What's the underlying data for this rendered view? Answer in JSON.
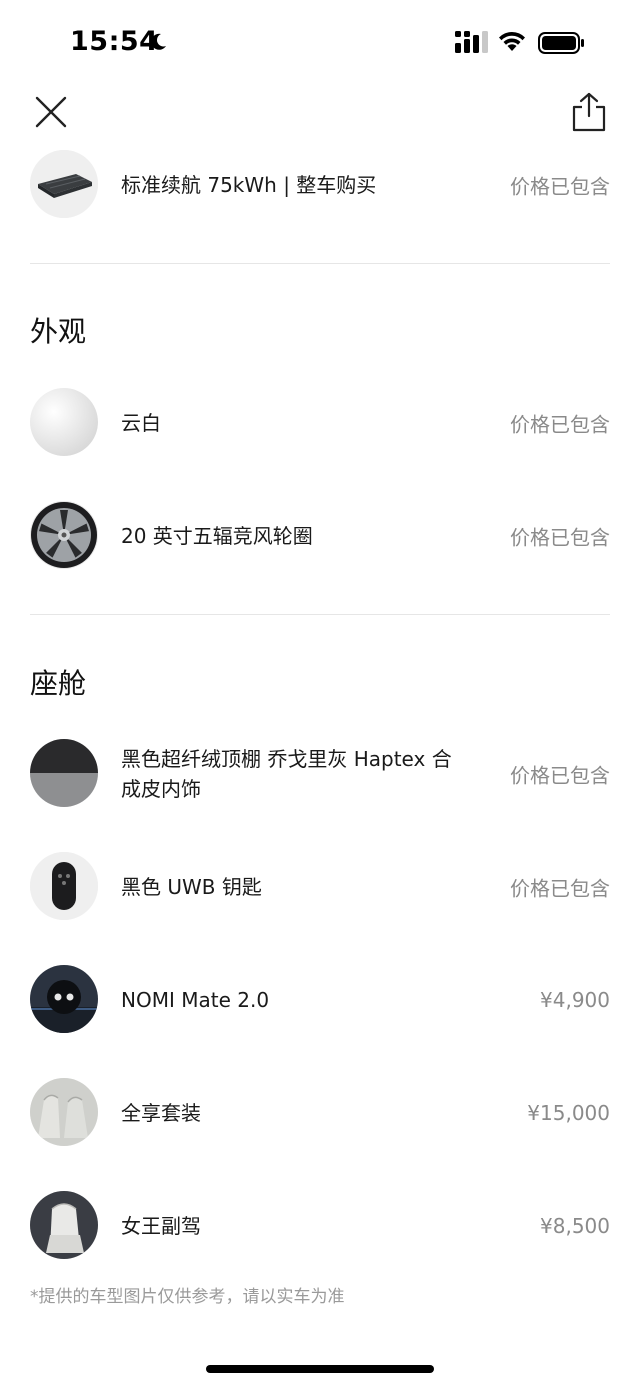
{
  "status_bar": {
    "time": "15:54"
  },
  "sections": {
    "battery_item": {
      "label": "标准续航 75kWh | 整车购买",
      "price": "价格已包含"
    },
    "exterior": {
      "title": "外观",
      "items": [
        {
          "label": "云白",
          "price": "价格已包含",
          "icon": "white-paint-swatch"
        },
        {
          "label": "20 英寸五辐竞风轮圈",
          "price": "价格已包含",
          "icon": "wheel-rim"
        }
      ]
    },
    "cabin": {
      "title": "座舱",
      "items": [
        {
          "label": "黑色超纤绒顶棚 乔戈里灰 Haptex 合成皮内饰",
          "price": "价格已包含",
          "icon": "interior-trim-swatch"
        },
        {
          "label": "黑色 UWB 钥匙",
          "price": "价格已包含",
          "icon": "key-fob"
        },
        {
          "label": "NOMI Mate 2.0",
          "price": "¥4,900",
          "icon": "nomi-robot"
        },
        {
          "label": "全享套装",
          "price": "¥15,000",
          "icon": "seat-package"
        },
        {
          "label": "女王副驾",
          "price": "¥8,500",
          "icon": "passenger-seat"
        }
      ]
    }
  },
  "footnote": "*提供的车型图片仅供参考，请以实车为准"
}
